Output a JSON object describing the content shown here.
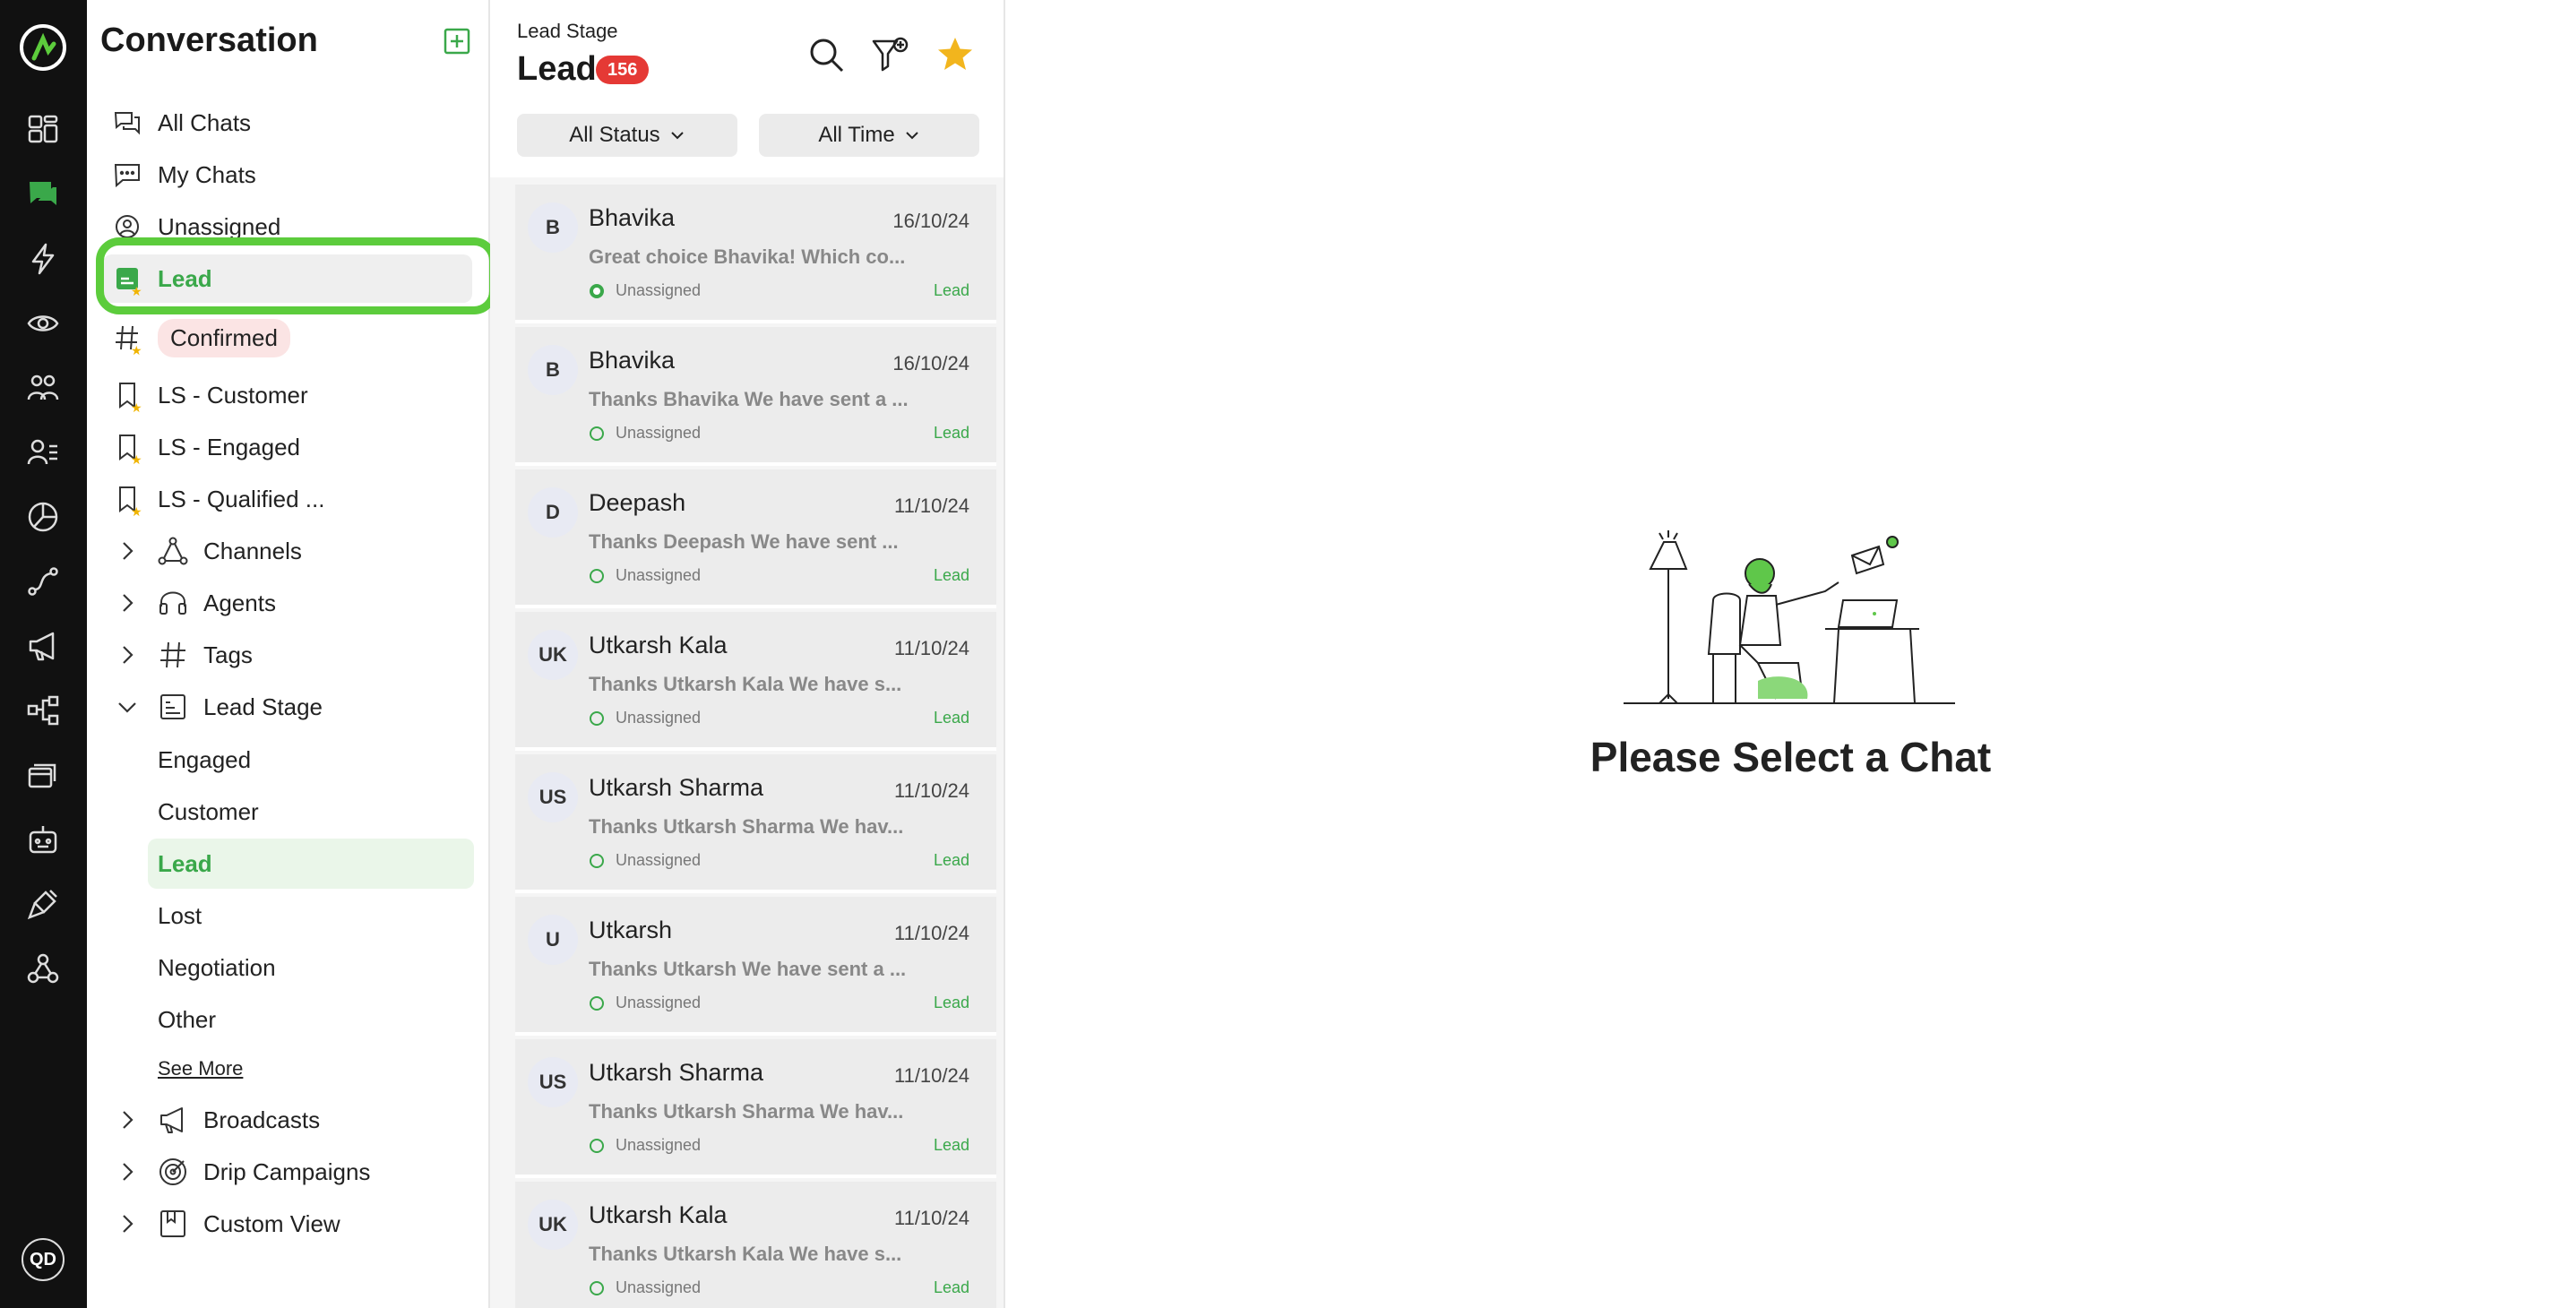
{
  "rail": {
    "icons": [
      "logo-icon",
      "dashboard-icon",
      "chat-icon",
      "bolt-icon",
      "eye-icon",
      "team-icon",
      "contacts-icon",
      "analytics-icon",
      "flow-icon",
      "megaphone-icon",
      "integrations-icon",
      "templates-icon",
      "bot-icon",
      "plugin-icon",
      "webhook-icon"
    ],
    "avatar": "QD"
  },
  "sidebar": {
    "title": "Conversation",
    "items": [
      {
        "label": "All Chats",
        "icon": "chats-icon"
      },
      {
        "label": "My Chats",
        "icon": "chat-bubble-icon"
      },
      {
        "label": "Unassigned",
        "icon": "unassigned-icon"
      },
      {
        "label": "Lead",
        "icon": "lead-icon"
      },
      {
        "label": "Confirmed",
        "icon": "hash-icon"
      },
      {
        "label": "LS - Customer",
        "icon": "bookmark-icon"
      },
      {
        "label": "LS - Engaged",
        "icon": "bookmark-icon"
      },
      {
        "label": "LS - Qualified ...",
        "icon": "bookmark-icon"
      }
    ],
    "groups": [
      {
        "label": "Channels",
        "icon": "channels-icon"
      },
      {
        "label": "Agents",
        "icon": "headset-icon"
      },
      {
        "label": "Tags",
        "icon": "hash-icon"
      },
      {
        "label": "Lead Stage",
        "icon": "stage-icon"
      }
    ],
    "lead_stage_items": [
      "Engaged",
      "Customer",
      "Lead",
      "Lost",
      "Negotiation",
      "Other"
    ],
    "see_more": "See More",
    "bottom_groups": [
      {
        "label": "Broadcasts",
        "icon": "megaphone-icon"
      },
      {
        "label": "Drip Campaigns",
        "icon": "target-icon"
      },
      {
        "label": "Custom View",
        "icon": "bookmark-icon"
      }
    ]
  },
  "list": {
    "caption": "Lead Stage",
    "title": "Lead",
    "count": "156",
    "filters": {
      "status": "All Status",
      "time": "All Time"
    },
    "chats": [
      {
        "initials": "B",
        "name": "Bhavika",
        "date": "16/10/24",
        "message": "Great choice Bhavika! Which co...",
        "assignee": "Unassigned",
        "tag": "Lead"
      },
      {
        "initials": "B",
        "name": "Bhavika",
        "date": "16/10/24",
        "message": "Thanks Bhavika We have sent a ...",
        "assignee": "Unassigned",
        "tag": "Lead"
      },
      {
        "initials": "D",
        "name": "Deepash",
        "date": "11/10/24",
        "message": "Thanks Deepash We have sent ...",
        "assignee": "Unassigned",
        "tag": "Lead"
      },
      {
        "initials": "UK",
        "name": "Utkarsh Kala",
        "date": "11/10/24",
        "message": "Thanks Utkarsh Kala We have s...",
        "assignee": "Unassigned",
        "tag": "Lead"
      },
      {
        "initials": "US",
        "name": "Utkarsh Sharma",
        "date": "11/10/24",
        "message": "Thanks Utkarsh Sharma We hav...",
        "assignee": "Unassigned",
        "tag": "Lead"
      },
      {
        "initials": "U",
        "name": "Utkarsh",
        "date": "11/10/24",
        "message": "Thanks Utkarsh We have sent a ...",
        "assignee": "Unassigned",
        "tag": "Lead"
      },
      {
        "initials": "US",
        "name": "Utkarsh Sharma",
        "date": "11/10/24",
        "message": "Thanks Utkarsh Sharma We hav...",
        "assignee": "Unassigned",
        "tag": "Lead"
      },
      {
        "initials": "UK",
        "name": "Utkarsh Kala",
        "date": "11/10/24",
        "message": "Thanks Utkarsh Kala We have s...",
        "assignee": "Unassigned",
        "tag": "Lead"
      }
    ]
  },
  "main": {
    "empty_text": "Please Select a Chat"
  },
  "colors": {
    "accent": "#3aa84a",
    "highlight": "#5ccc3c",
    "badge": "#e53935",
    "rail": "#111111"
  }
}
